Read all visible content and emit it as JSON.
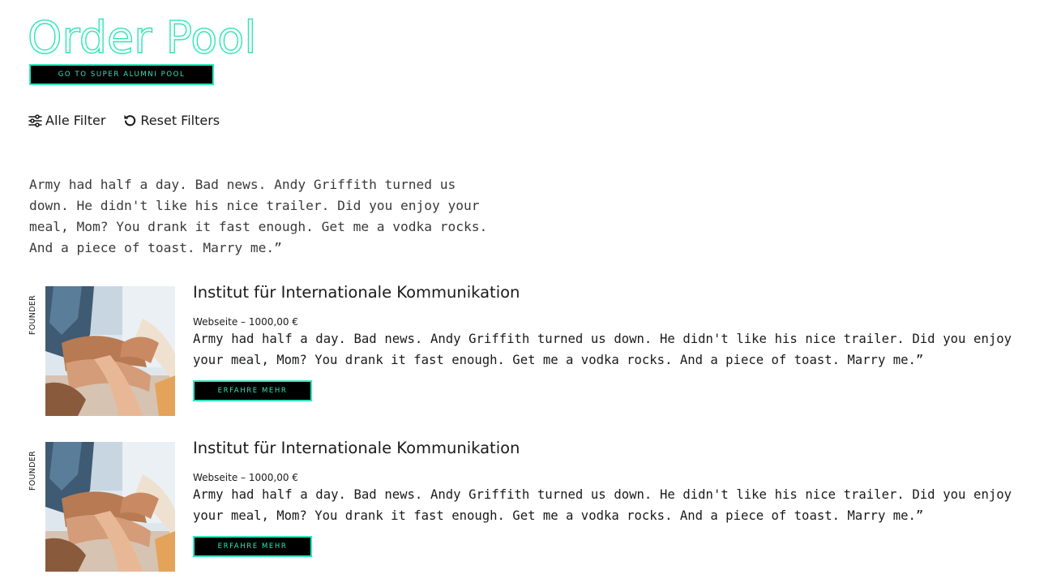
{
  "page": {
    "title": "Order Pool",
    "alumni_button": "GO TO SUPER ALUMNI POOL"
  },
  "filters": {
    "all_filters_label": "Alle Filter",
    "all_filters_icon": "sliders-icon",
    "reset_label": "Reset Filters",
    "reset_icon": "reset-icon"
  },
  "intro_text": "Army had half a day. Bad news. Andy Griffith turned us down. He didn't like his nice trailer. Did you enjoy your meal, Mom? You drank it fast enough. Get me a vodka rocks. And a piece of toast. Marry me.”",
  "entries": [
    {
      "side_label": "FOUNDER",
      "title": "Institut für Internationale Kommunikation",
      "meta": "Webseite – 1000,00 €",
      "description": "Army had half a day. Bad news. Andy Griffith turned us down. He didn't like his nice trailer. Did you enjoy your meal, Mom? You drank it fast enough. Get me a vodka rocks. And a piece of toast. Marry me.”",
      "button": "ERFAHRE MEHR"
    },
    {
      "side_label": "FOUNDER",
      "title": "Institut für Internationale Kommunikation",
      "meta": "Webseite – 1000,00 €",
      "description": "Army had half a day. Bad news. Andy Griffith turned us down. He didn't like his nice trailer. Did you enjoy your meal, Mom? You drank it fast enough. Get me a vodka rocks. And a piece of toast. Marry me.”",
      "button": "ERFAHRE MEHR"
    }
  ],
  "colors": {
    "accent": "#2ee6b8",
    "button_bg": "#000000",
    "text": "#1a1a1a",
    "intro_text": "#3a3a3a"
  }
}
